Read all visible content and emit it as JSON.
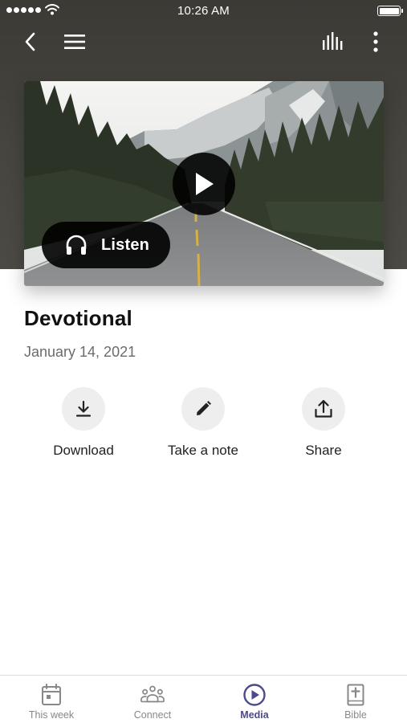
{
  "status_bar": {
    "time": "10:26 AM"
  },
  "toolbar": {
    "back_icon": "chevron-left-icon",
    "menu_icon": "hamburger-icon",
    "audio_icon": "equalizer-icon",
    "more_icon": "more-vertical-icon"
  },
  "media": {
    "play_icon": "play-icon",
    "listen_label": "Listen",
    "title": "Devotional",
    "date": "January 14, 2021"
  },
  "actions": [
    {
      "label": "Download",
      "icon": "download-icon"
    },
    {
      "label": "Take a note",
      "icon": "pencil-icon"
    },
    {
      "label": "Share",
      "icon": "share-icon"
    }
  ],
  "tabs": [
    {
      "label": "This week",
      "icon": "calendar-icon",
      "active": false
    },
    {
      "label": "Connect",
      "icon": "people-icon",
      "active": false
    },
    {
      "label": "Media",
      "icon": "play-circle-icon",
      "active": true
    },
    {
      "label": "Bible",
      "icon": "bible-icon",
      "active": false
    }
  ],
  "colors": {
    "header_bg": "#45433d",
    "active_tab": "#4b4a8a",
    "inactive_tab": "#888888",
    "action_circle": "#eeeeee"
  }
}
